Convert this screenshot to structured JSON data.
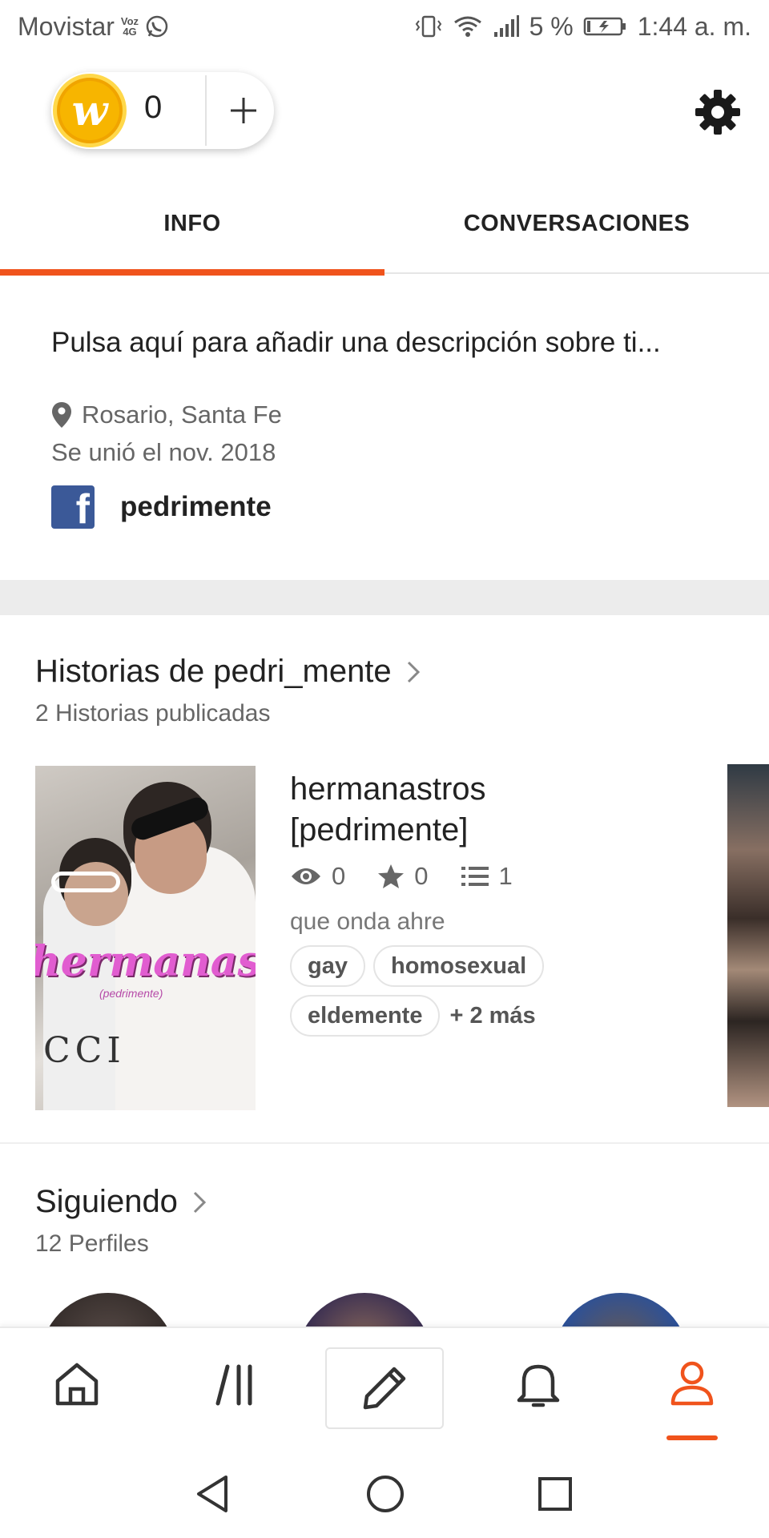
{
  "status_bar": {
    "carrier": "Movistar",
    "network_badge_top": "Voz",
    "network_badge_bottom": "4G",
    "battery": "5 %",
    "time": "1:44 a. m."
  },
  "header": {
    "coins": "0",
    "coin_logo": "w"
  },
  "tabs": [
    {
      "label": "INFO",
      "active": true
    },
    {
      "label": "CONVERSACIONES",
      "active": false
    }
  ],
  "profile": {
    "description_prompt": "Pulsa aquí para añadir una descripción sobre ti...",
    "location": "Rosario, Santa Fe",
    "joined": "Se unió el nov. 2018",
    "facebook_name": "pedrimente"
  },
  "stories_section": {
    "title": "Historias de pedri_mente",
    "subtitle": "2 Historias publicadas",
    "story": {
      "title": "hermanastros [pedrimente]",
      "cover_title": "hermanastros",
      "cover_subtitle": "(pedrimente)",
      "cover_logo_text": "CCI",
      "views": "0",
      "votes": "0",
      "parts": "1",
      "description": "que onda ahre",
      "tags": [
        "gay",
        "homosexual",
        "eldemente"
      ],
      "more_tags": "+ 2 más"
    }
  },
  "following_section": {
    "title": "Siguiendo",
    "subtitle": "12 Perfiles"
  },
  "colors": {
    "accent": "#f0531c",
    "coin": "#f7b500",
    "facebook": "#3b5998"
  },
  "icons": {
    "nav": [
      "home-icon",
      "library-icon",
      "write-icon",
      "notifications-icon",
      "profile-icon"
    ],
    "system": [
      "back-icon",
      "home-circle-icon",
      "recents-icon"
    ]
  }
}
